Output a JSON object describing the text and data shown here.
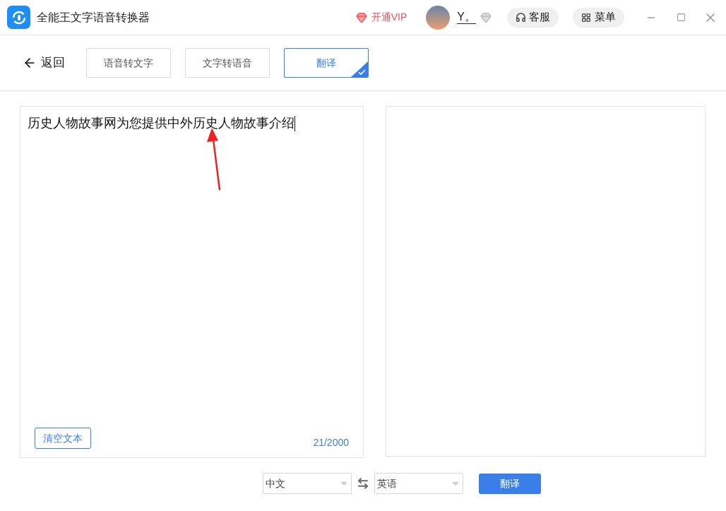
{
  "window": {
    "title": "全能王文字语音转换器"
  },
  "header": {
    "vip": "开通VIP",
    "user": "Y。",
    "service": "客服",
    "menu": "菜单"
  },
  "toolbar": {
    "back": "返回",
    "tabs": [
      {
        "label": "语音转文字",
        "selected": false
      },
      {
        "label": "文字转语音",
        "selected": false
      },
      {
        "label": "翻译",
        "selected": true
      }
    ]
  },
  "source": {
    "value": "历史人物故事网为您提供中外历史人物故事介绍",
    "clear": "清空文本",
    "count": "21/2000"
  },
  "footer": {
    "source_lang": "中文",
    "target_lang": "英语",
    "translate": "翻译"
  }
}
